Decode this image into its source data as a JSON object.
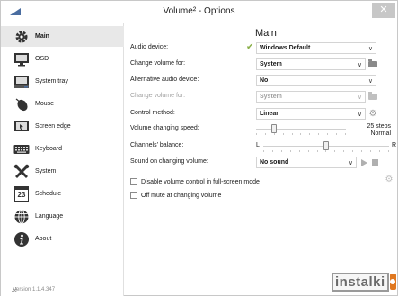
{
  "window": {
    "title": "Volume² - Options",
    "close_label": "✕"
  },
  "sidebar": {
    "items": [
      {
        "label": "Main",
        "icon": "gear-icon",
        "active": true
      },
      {
        "label": "OSD",
        "icon": "monitor-icon",
        "active": false
      },
      {
        "label": "System tray",
        "icon": "tray-icon",
        "active": false
      },
      {
        "label": "Mouse",
        "icon": "mouse-icon",
        "active": false
      },
      {
        "label": "Screen edge",
        "icon": "screen-edge-icon",
        "active": false
      },
      {
        "label": "Keyboard",
        "icon": "keyboard-icon",
        "active": false
      },
      {
        "label": "System",
        "icon": "tools-icon",
        "active": false
      },
      {
        "label": "Schedule",
        "icon": "calendar-icon",
        "active": false
      },
      {
        "label": "Language",
        "icon": "globe-icon",
        "active": false
      },
      {
        "label": "About",
        "icon": "info-icon",
        "active": false
      }
    ],
    "calendar_day": "23",
    "version": "version 1.1.4.347"
  },
  "main": {
    "title": "Main",
    "audio_device": {
      "label": "Audio device:",
      "value": "Windows Default"
    },
    "change_volume_for": {
      "label": "Change volume for:",
      "value": "System"
    },
    "alt_audio_device": {
      "label": "Alternative audio device:",
      "value": "No"
    },
    "change_volume_for_disabled": {
      "label": "Change volume for:",
      "value": "System"
    },
    "control_method": {
      "label": "Control method:",
      "value": "Linear"
    },
    "volume_speed": {
      "label": "Volume changing speed:",
      "value_line1": "25 steps",
      "value_line2": "Normal",
      "position": 0.2
    },
    "channels_balance": {
      "label": "Channels' balance:",
      "left": "L",
      "right": "R",
      "position": 0.5
    },
    "sound_on_change": {
      "label": "Sound on changing volume:",
      "value": "No sound"
    },
    "disable_fullscreen": {
      "label": "Disable volume control in full-screen mode",
      "checked": false
    },
    "off_mute": {
      "label": "Off mute at changing volume",
      "checked": false
    }
  },
  "watermark": {
    "text": "instalki"
  },
  "colors": {
    "accent": "#4a6da0",
    "check": "#8ab04a",
    "watermark_badge": "#e07820"
  }
}
